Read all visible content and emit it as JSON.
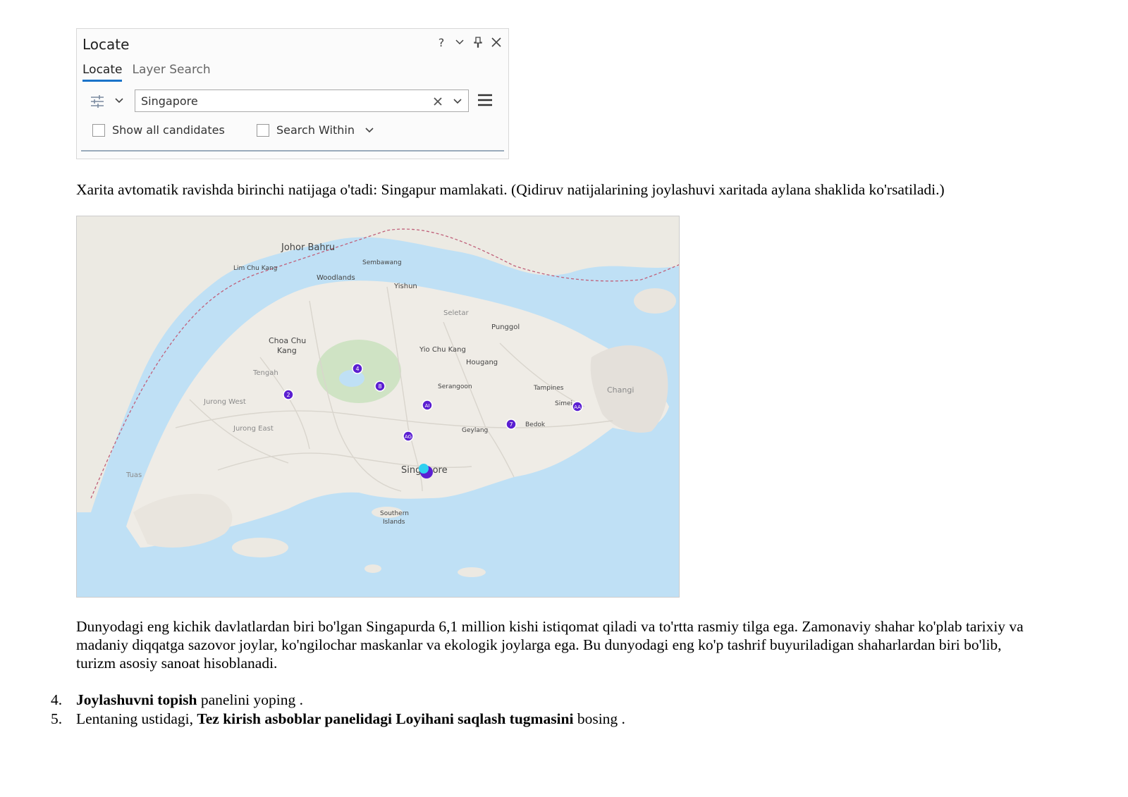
{
  "pane": {
    "title": "Locate",
    "tabs": [
      {
        "label": "Locate",
        "active": true
      },
      {
        "label": "Layer Search",
        "active": false
      }
    ],
    "controls": [
      "help-icon",
      "chevron-down-icon",
      "pin-icon",
      "close-icon"
    ],
    "search": {
      "value": "Singapore",
      "placeholder": ""
    },
    "options": [
      {
        "label": "Show all candidates",
        "checked": false
      },
      {
        "label": "Search Within",
        "checked": false
      }
    ]
  },
  "text": {
    "p1": "Xarita avtomatik ravishda birinchi natijaga o'tadi: Singapur mamlakati. (Qidiruv natijalarining joylashuvi xaritada aylana shaklida ko'rsatiladi.)",
    "p2": "Dunyodagi eng kichik davlatlardan biri bo'lgan Singapurda 6,1 million kishi istiqomat qiladi va to'rtta rasmiy tilga ega. Zamonaviy shahar ko'plab tarixiy va madaniy diqqatga sazovor joylar, ko'ngilochar maskanlar va ekologik joylarga ega. Bu dunyodagi eng ko'p tashrif buyuriladigan shaharlardan biri bo'lib, turizm asosiy sanoat hisoblanadi."
  },
  "list": [
    {
      "num": "4.",
      "bold": "Joylashuvni topish",
      "rest": " panelini yoping ."
    },
    {
      "num": "5.",
      "pre": "Lentaning ustidagi, ",
      "bold": "Tez kirish asboblar panelidagi Loyihani saqlash tugmasini",
      "rest": " bosing ."
    }
  ],
  "map": {
    "labels": {
      "johor_bahru": "Johor Bahru",
      "sembawang": "Sembawang",
      "lim_chu_kang": "Lim Chu Kang",
      "woodlands": "Woodlands",
      "yishun": "Yishun",
      "punggol": "Punggol",
      "choa_chu_kang": "Choa Chu",
      "choa_chu_kang2": "Kang",
      "yio_chu_kang": "Yio Chu Kang",
      "hougang": "Hougang",
      "serangoon": "Serangoon",
      "tampines": "Tampines",
      "simei": "Simei",
      "geylang": "Geylang",
      "bedok": "Bedok",
      "changi": "Changi",
      "singapore": "Singapore",
      "southern_islands": "Southern",
      "southern_islands2": "Islands",
      "seletar": "Seletar",
      "jurong_west": "Jurong West",
      "jurong_east": "Jurong East",
      "tengah": "Tengah",
      "tuas": "Tuas"
    },
    "markers": [
      {
        "label": "4"
      },
      {
        "label": "2"
      },
      {
        "label": "8"
      },
      {
        "label": "AI"
      },
      {
        "label": "AG"
      },
      {
        "label": "7"
      },
      {
        "label": "AA"
      }
    ],
    "colors": {
      "water": "#bfe0f5",
      "land": "#efece6",
      "marker": "#5b1fd1",
      "highlight": "#2fd0f0"
    }
  }
}
